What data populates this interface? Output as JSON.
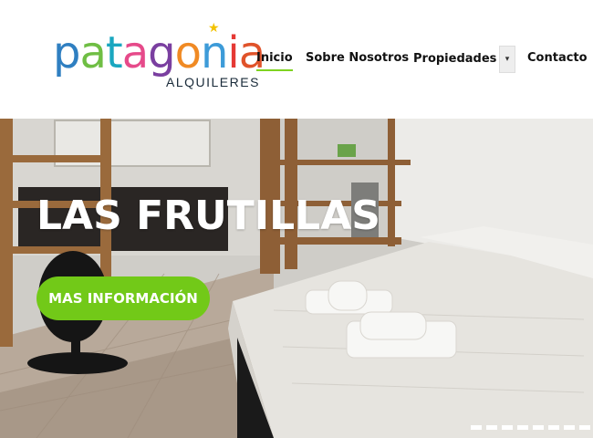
{
  "header": {
    "logo": {
      "word": "patagonia",
      "letters": [
        {
          "ch": "p",
          "color": "#2f7fc1"
        },
        {
          "ch": "a",
          "color": "#6fbe44"
        },
        {
          "ch": "t",
          "color": "#1aa7c0"
        },
        {
          "ch": "a",
          "color": "#e64a8a"
        },
        {
          "ch": "g",
          "color": "#7a3fa0"
        },
        {
          "ch": "o",
          "color": "#f08a24"
        },
        {
          "ch": "n",
          "color": "#3d9bd8"
        },
        {
          "ch": "i",
          "color": "#e53935"
        },
        {
          "ch": "a",
          "color": "#e0532a"
        }
      ],
      "subtitle": "ALQUILERES",
      "star_color": "#f2c200"
    },
    "nav": {
      "items": [
        "Inicio",
        "Sobre Nosotros",
        "Propiedades",
        "Contacto"
      ],
      "active": "Inicio",
      "dropdown_icon": "caret-down-icon"
    }
  },
  "hero": {
    "title": "LAS FRUTILLAS",
    "cta_label": "MAS INFORMACIÓN",
    "cta_color": "#72c918",
    "slide_dots": 8
  },
  "colors": {
    "accent": "#7ed321",
    "text": "#111111"
  }
}
